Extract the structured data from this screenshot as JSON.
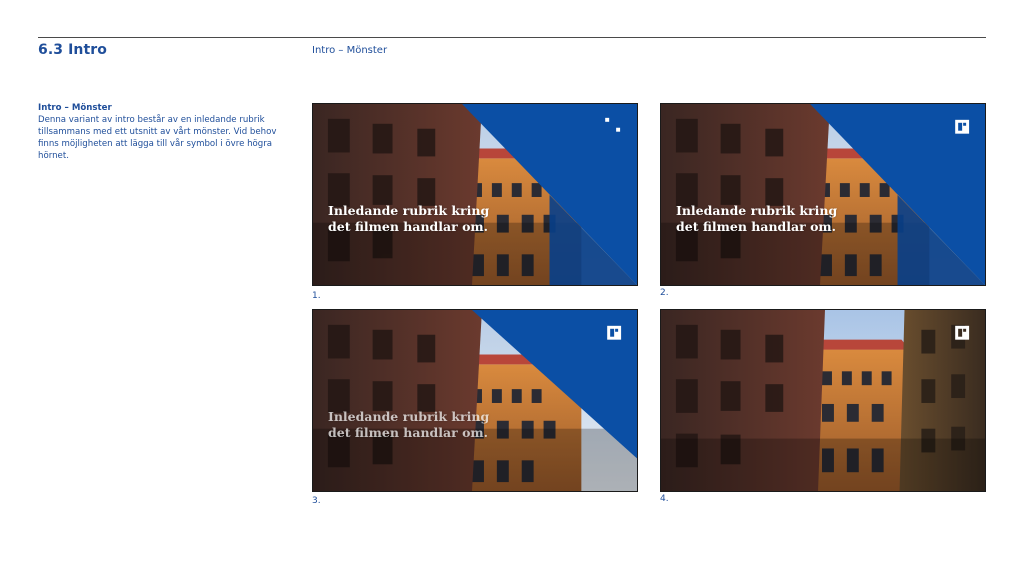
{
  "header": {
    "section_title": "6.3 Intro",
    "subtitle": "Intro – Mönster"
  },
  "description": {
    "title": "Intro – Mönster",
    "body": "Denna variant av intro består av en inledande rubrik tillsammans med ett utsnitt av vårt mönster. Vid behov finns möjligheten att lägga till vår symbol i övre högra hörnet."
  },
  "examples": [
    {
      "caption": "1.",
      "headline_line1": "Inledande rubrik kring",
      "headline_line2": "det filmen handlar om.",
      "pattern": "blue-triangle-full",
      "symbol": "dots-pattern-icon"
    },
    {
      "caption": "2.",
      "headline_line1": "Inledande rubrik kring",
      "headline_line2": "det filmen handlar om.",
      "pattern": "blue-triangle-full",
      "symbol": "logo-symbol-icon"
    },
    {
      "caption": "3.",
      "headline_line1": "Inledande rubrik kring",
      "headline_line2": "det filmen handlar om.",
      "pattern": "blue-triangle-half",
      "symbol": "logo-symbol-icon"
    },
    {
      "caption": "4.",
      "pattern": "none",
      "symbol": "logo-symbol-icon"
    }
  ],
  "colors": {
    "brand_blue": "#1f4e9a",
    "pattern_blue": "#0b4fa5",
    "pattern_blue_dark": "#083f8a"
  }
}
